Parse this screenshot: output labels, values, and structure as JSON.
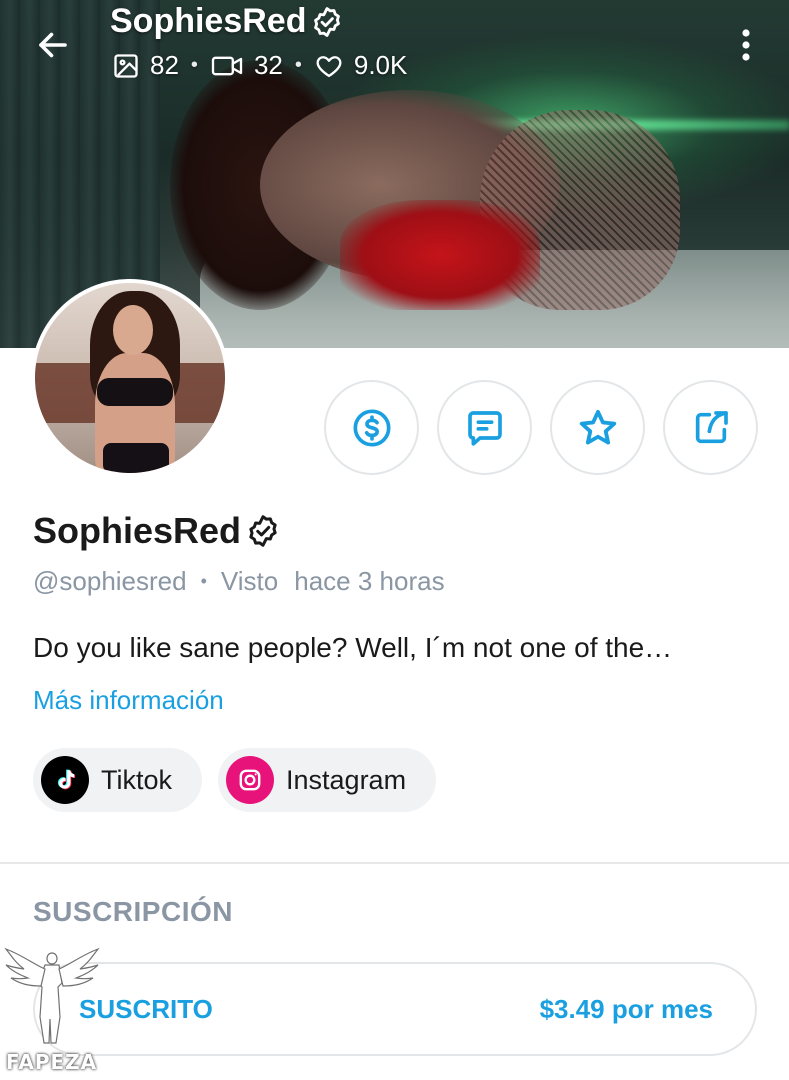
{
  "header": {
    "title": "SophiesRed",
    "stats": {
      "photos": "82",
      "videos": "32",
      "likes": "9.0K"
    }
  },
  "actions": [
    {
      "name": "tip",
      "icon": "dollar-icon"
    },
    {
      "name": "message",
      "icon": "message-icon"
    },
    {
      "name": "favorite",
      "icon": "star-icon"
    },
    {
      "name": "share",
      "icon": "share-icon"
    }
  ],
  "profile": {
    "display_name": "SophiesRed",
    "username": "@sophiesred",
    "seen_label": "Visto",
    "seen_time": "hace 3 horas",
    "bio": "Do you like sane people? Well, I´m not one of the…",
    "more_info": "Más información"
  },
  "social_links": [
    {
      "label": "Tiktok",
      "icon": "tiktok-icon"
    },
    {
      "label": "Instagram",
      "icon": "instagram-icon"
    }
  ],
  "subscription": {
    "section_title": "SUSCRIPCIÓN",
    "status": "SUSCRITO",
    "price": "$3.49 por mes"
  },
  "watermark": {
    "text": "FAPEZA"
  },
  "colors": {
    "accent": "#1aa0e0",
    "muted": "#8a96a3",
    "instagram": "#e8137a",
    "tiktok": "#000000"
  }
}
